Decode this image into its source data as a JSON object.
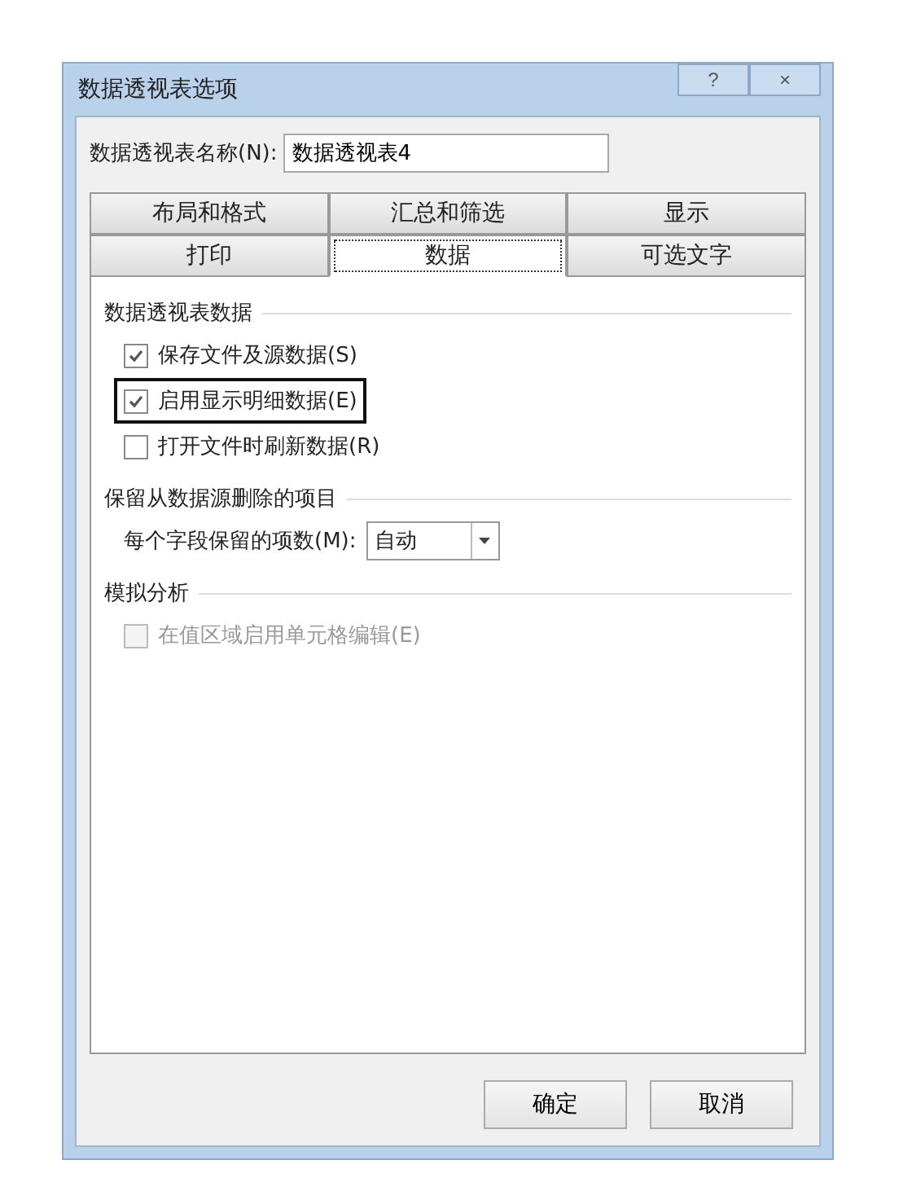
{
  "window": {
    "title": "数据透视表选项",
    "help": "?",
    "close": "×"
  },
  "name_field": {
    "label": "数据透视表名称(N):",
    "value": "数据透视表4"
  },
  "tab_rows": [
    [
      {
        "label": "布局和格式",
        "selected": false
      },
      {
        "label": "汇总和筛选",
        "selected": false
      },
      {
        "label": "显示",
        "selected": false
      }
    ],
    [
      {
        "label": "打印",
        "selected": false
      },
      {
        "label": "数据",
        "selected": true
      },
      {
        "label": "可选文字",
        "selected": false
      }
    ]
  ],
  "sections": [
    {
      "title": "数据透视表数据",
      "items": [
        {
          "kind": "checkbox",
          "label": "保存文件及源数据(S)",
          "checked": true,
          "disabled": false,
          "highlighted": false
        },
        {
          "kind": "checkbox",
          "label": "启用显示明细数据(E)",
          "checked": true,
          "disabled": false,
          "highlighted": true
        },
        {
          "kind": "checkbox",
          "label": "打开文件时刷新数据(R)",
          "checked": false,
          "disabled": false,
          "highlighted": false
        }
      ]
    },
    {
      "title": "保留从数据源删除的项目",
      "items": [
        {
          "kind": "dropdown",
          "label": "每个字段保留的项数(M):",
          "value": "自动"
        }
      ]
    },
    {
      "title": "模拟分析",
      "items": [
        {
          "kind": "checkbox",
          "label": "在值区域启用单元格编辑(E)",
          "checked": false,
          "disabled": true,
          "highlighted": false
        }
      ]
    }
  ],
  "buttons": [
    "确定",
    "取消"
  ]
}
